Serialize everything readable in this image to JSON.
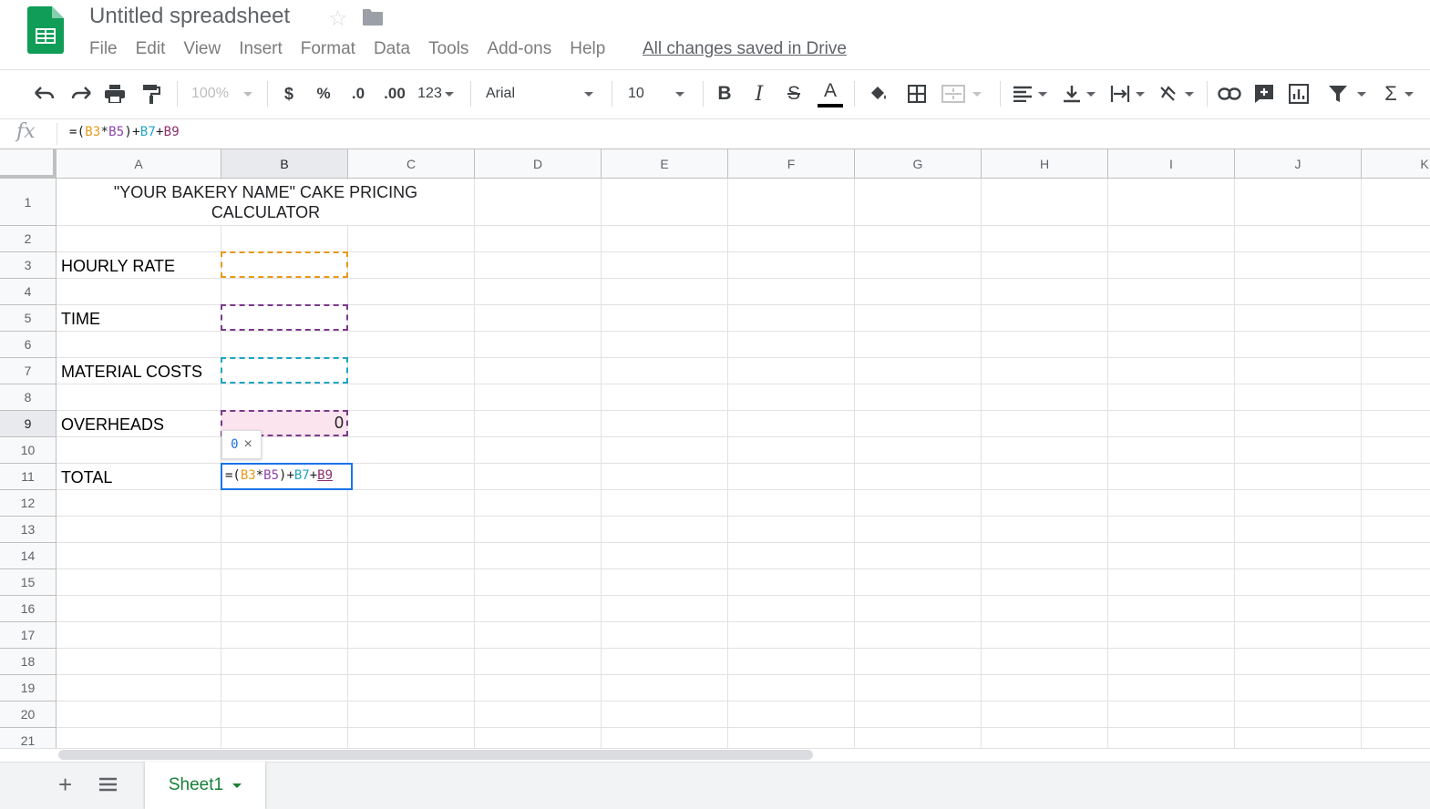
{
  "header": {
    "title": "Untitled spreadsheet",
    "menu": [
      "File",
      "Edit",
      "View",
      "Insert",
      "Format",
      "Data",
      "Tools",
      "Add-ons",
      "Help"
    ],
    "save_status": "All changes saved in Drive"
  },
  "toolbar": {
    "zoom": "100%",
    "currency": "$",
    "percent": "%",
    "decrease_decimal": ".0",
    "increase_decimal": ".00",
    "more_formats": "123",
    "font": "Arial",
    "font_size": "10"
  },
  "formula_bar": {
    "fx_label": "fx",
    "formula_parts": [
      "=(",
      "B3",
      "*",
      "B5",
      ")+",
      "B7",
      "+",
      "B9"
    ]
  },
  "grid": {
    "columns": [
      "A",
      "B",
      "C",
      "D",
      "E",
      "F",
      "G",
      "H",
      "I",
      "J",
      "K"
    ],
    "rows": [
      "1",
      "2",
      "3",
      "4",
      "5",
      "6",
      "7",
      "8",
      "9",
      "10",
      "11",
      "12",
      "13",
      "14",
      "15",
      "16",
      "17",
      "18",
      "19",
      "20",
      "21"
    ],
    "selected_column": "B",
    "selected_row": "9"
  },
  "cells": {
    "A1": "\"YOUR BAKERY NAME\" CAKE PRICING CALCULATOR",
    "A3": "HOURLY RATE",
    "A5": "TIME",
    "A7": "MATERIAL COSTS",
    "A9": "OVERHEADS",
    "A11": "TOTAL",
    "B9": "0"
  },
  "tooltip": {
    "value": "0",
    "close": "×"
  },
  "sheets": {
    "active": "Sheet1"
  },
  "colors": {
    "ref_b3": "#e69a1b",
    "ref_b5": "#8e44ad",
    "ref_b7": "#1fa5c2",
    "ref_b9": "#8e2d6e",
    "selection": "#1a73e8",
    "sheets_green": "#188038"
  }
}
